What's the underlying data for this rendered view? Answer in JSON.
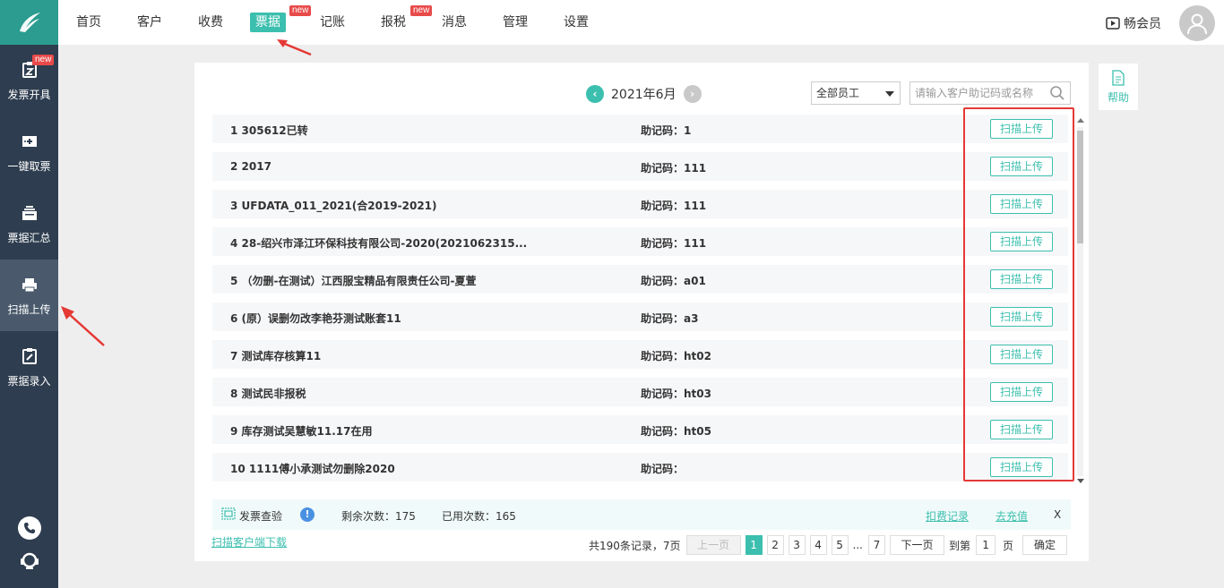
{
  "sidebar": {
    "items": [
      {
        "label": "发票开具",
        "icon": "invoice-issue-icon",
        "badge": "new"
      },
      {
        "label": "一键取票",
        "icon": "one-click-fetch-icon"
      },
      {
        "label": "票据汇总",
        "icon": "summary-icon"
      },
      {
        "label": "扫描上传",
        "icon": "scanner-icon",
        "active": true
      },
      {
        "label": "票据录入",
        "icon": "entry-icon"
      }
    ]
  },
  "nav": {
    "items": [
      {
        "label": "首页"
      },
      {
        "label": "客户"
      },
      {
        "label": "收费"
      },
      {
        "label": "票据",
        "active": true,
        "badge": "new"
      },
      {
        "label": "记账"
      },
      {
        "label": "报税",
        "badge": "new"
      },
      {
        "label": "消息"
      },
      {
        "label": "管理"
      },
      {
        "label": "设置"
      }
    ],
    "member_label": "畅会员"
  },
  "toolbar": {
    "month": "2021年6月",
    "employee_select": "全部员工",
    "search_placeholder": "请输入客户助记码或名称"
  },
  "rows": [
    {
      "name": "1 305612已转",
      "code": "助记码：1",
      "action": "扫描上传"
    },
    {
      "name": "2 2017",
      "code": "助记码：111",
      "action": "扫描上传"
    },
    {
      "name": "3 UFDATA_011_2021(合2019-2021)",
      "code": "助记码：111",
      "action": "扫描上传"
    },
    {
      "name": "4 28-绍兴市泽江环保科技有限公司-2020(2021062315...",
      "code": "助记码：111",
      "action": "扫描上传"
    },
    {
      "name": "5 （勿删-在测试）江西服宝精品有限责任公司-夏萱",
      "code": "助记码：a01",
      "action": "扫描上传"
    },
    {
      "name": "6 (原）误删勿改李艳芬测试账套11",
      "code": "助记码：a3",
      "action": "扫描上传"
    },
    {
      "name": "7 测试库存核算11",
      "code": "助记码：ht02",
      "action": "扫描上传"
    },
    {
      "name": "8 测试民非报税",
      "code": "助记码：ht03",
      "action": "扫描上传"
    },
    {
      "name": "9 库存测试吴慧敏11.17在用",
      "code": "助记码：ht05",
      "action": "扫描上传"
    },
    {
      "name": "10 1111傅小承测试勿删除2020",
      "code": "助记码：",
      "action": "扫描上传"
    }
  ],
  "info_bar": {
    "verify_label": "发票查验",
    "remaining": "剩余次数：175",
    "used": "已用次数：165",
    "deduct_link": "扣费记录",
    "recharge_link": "去充值",
    "close": "X"
  },
  "download_link": "扫描客户端下载",
  "pagination": {
    "total": "共190条记录，7页",
    "prev": "上一页",
    "pages": [
      "1",
      "2",
      "3",
      "4",
      "5"
    ],
    "ellipsis": "...",
    "last": "7",
    "next": "下一页",
    "goto": "到第",
    "goto_value": "1",
    "page_unit": "页",
    "confirm": "确定"
  },
  "help_label": "帮助",
  "colors": {
    "accent": "#3cbfae",
    "sidebar": "#2e3d4f",
    "annotation": "#e53935",
    "badge": "#e84a4a"
  }
}
